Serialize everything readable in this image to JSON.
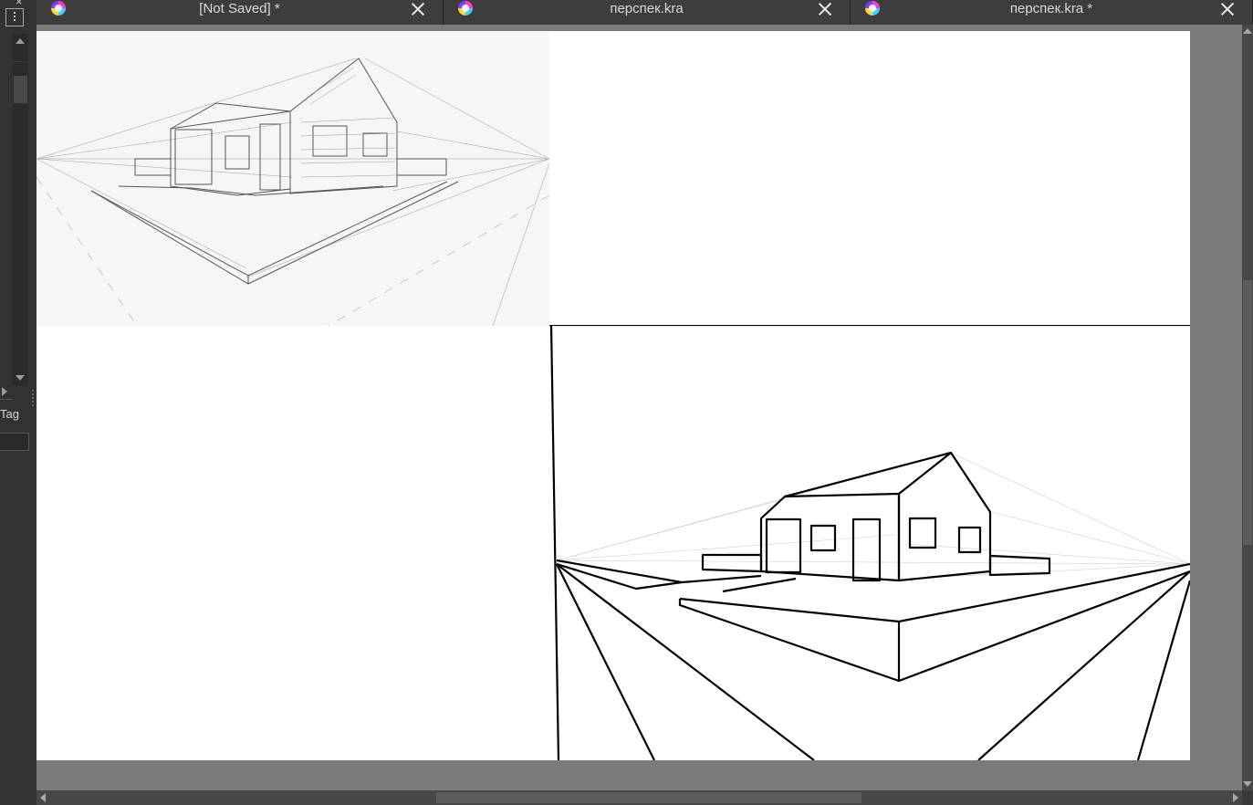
{
  "tabs": [
    {
      "title": "[Not Saved]  *",
      "icon": "krita-logo-icon"
    },
    {
      "title": "перспек.kra",
      "icon": "krita-logo-icon"
    },
    {
      "title": "перспек.kra *",
      "icon": "krita-logo-icon"
    }
  ],
  "left_docker": {
    "tag_label": "Tag",
    "tag_input_value": ""
  },
  "canvas": {
    "background": "#7b7b7b",
    "page_color": "#ffffff",
    "contents": [
      "reference-pencil-sketch-house",
      "two-point-perspective-lineart-house"
    ]
  },
  "colors": {
    "tab_active": "#3d3d3d",
    "docker_bg": "#323232",
    "scrollbar": "#474747"
  }
}
